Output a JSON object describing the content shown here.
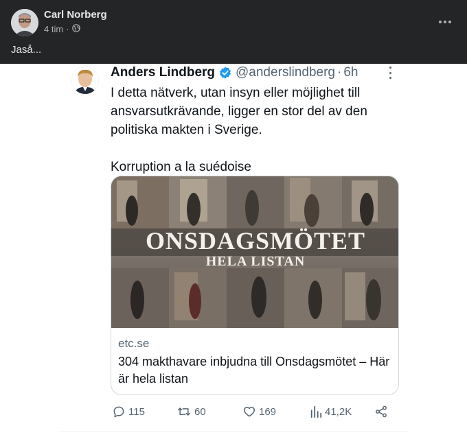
{
  "facebook_post": {
    "author": "Carl Norberg",
    "time": "4 tim",
    "separator": "·",
    "privacy_icon": "globe-icon",
    "text": "Jaså...",
    "more_icon": "more-horizontal-icon"
  },
  "tweet": {
    "name": "Anders Lindberg",
    "verified_icon": "verified-badge-icon",
    "handle": "@anderslindberg",
    "separator": "·",
    "time": "6h",
    "paragraphs": [
      "I detta nätverk, utan insyn eller möjlighet till ansvarsutkrävande, ligger en stor del av den politiska makten i Sverige.",
      "Korruption a la suédoise"
    ],
    "card": {
      "image_title": "ONSDAGSMÖTET",
      "image_subtitle": "HELA LISTAN",
      "domain": "etc.se",
      "title": "304 makthavare inbjudna till Onsdagsmötet – Här är hela listan"
    },
    "actions": {
      "replies": "115",
      "retweets": "60",
      "likes": "169",
      "views": "41,2K"
    }
  },
  "colors": {
    "fb_background": "#242526",
    "fb_text": "#e4e6eb",
    "fb_secondary": "#b0b3b8",
    "tweet_text": "#0f1419",
    "tweet_secondary": "#536471",
    "verified_blue": "#1d9bf0",
    "card_border": "#cfd9de"
  }
}
